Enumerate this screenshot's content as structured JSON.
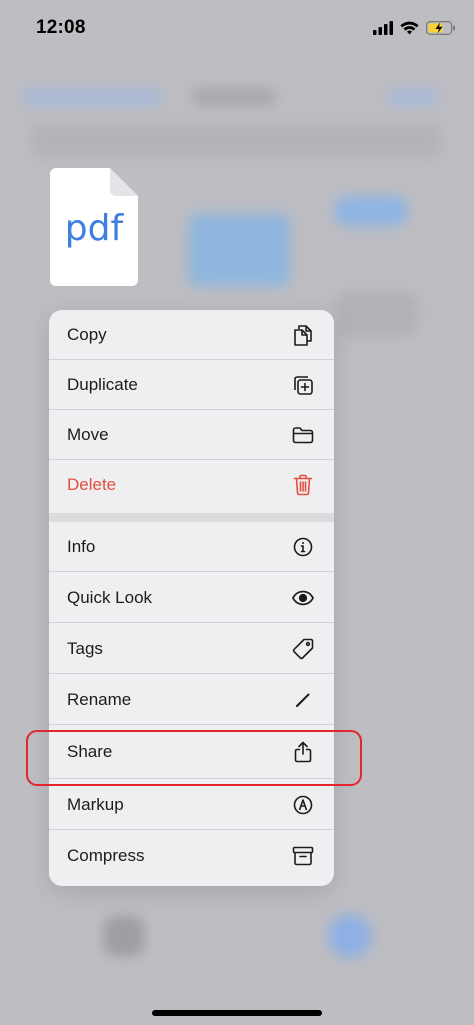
{
  "status_bar": {
    "time": "12:08",
    "icons": [
      "cellular-signal-icon",
      "wifi-icon",
      "battery-charging-icon"
    ]
  },
  "file": {
    "type_label": "pdf",
    "icon": "pdf-document-icon"
  },
  "menu": {
    "group_1": [
      {
        "label": "Copy",
        "icon": "copy-icon"
      },
      {
        "label": "Duplicate",
        "icon": "duplicate-icon"
      },
      {
        "label": "Move",
        "icon": "folder-icon"
      },
      {
        "label": "Delete",
        "icon": "trash-icon",
        "destructive": true
      }
    ],
    "group_2": [
      {
        "label": "Info",
        "icon": "info-icon"
      },
      {
        "label": "Quick Look",
        "icon": "eye-icon"
      },
      {
        "label": "Tags",
        "icon": "tag-icon"
      },
      {
        "label": "Rename",
        "icon": "pencil-icon"
      },
      {
        "label": "Share",
        "icon": "share-icon",
        "highlighted": true
      },
      {
        "label": "Markup",
        "icon": "markup-icon"
      },
      {
        "label": "Compress",
        "icon": "archive-box-icon"
      }
    ]
  },
  "colors": {
    "destructive": "#e0513f",
    "highlight_outline": "#e3272f",
    "pdf_accent": "#3f7fe0"
  }
}
